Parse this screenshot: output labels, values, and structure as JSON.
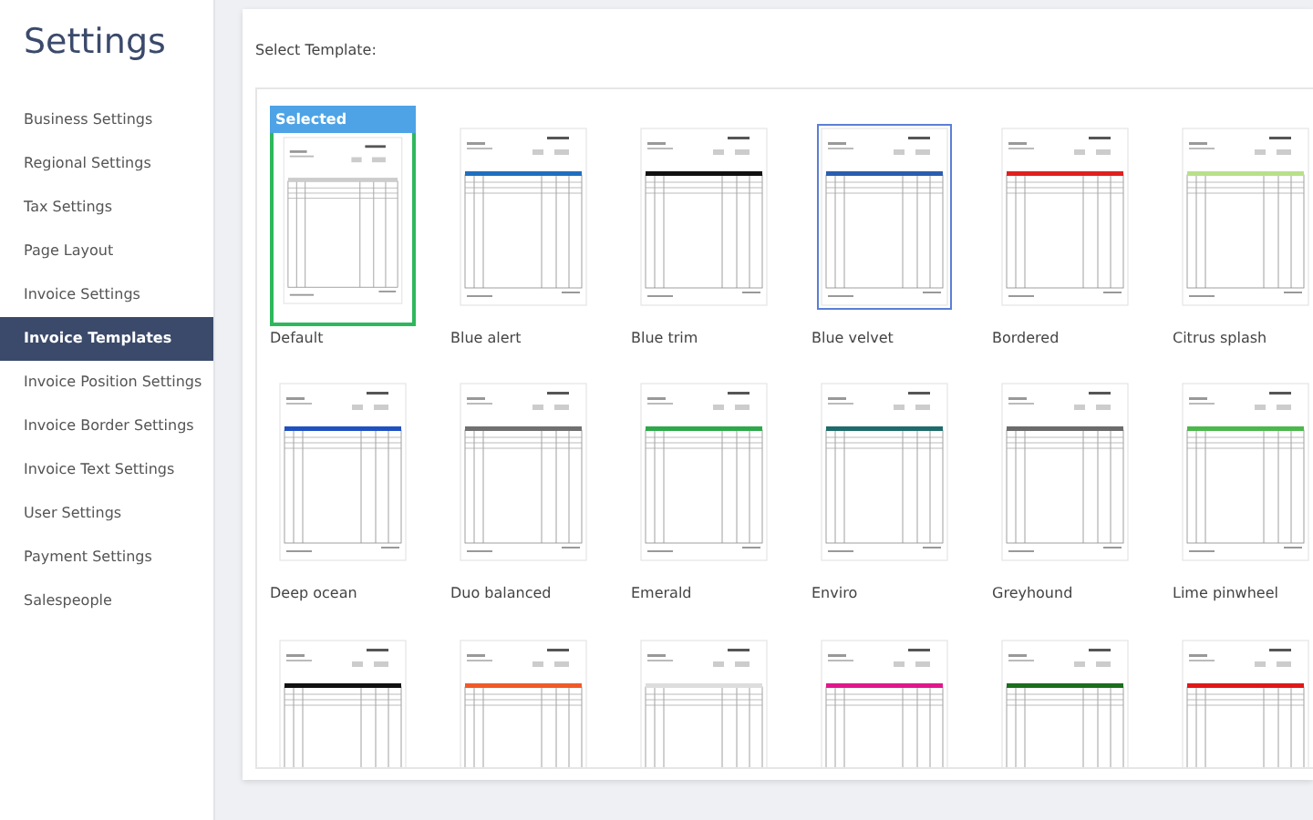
{
  "sidebar": {
    "title": "Settings",
    "items": [
      {
        "label": "Business Settings",
        "selected": false
      },
      {
        "label": "Regional Settings",
        "selected": false
      },
      {
        "label": "Tax Settings",
        "selected": false
      },
      {
        "label": "Page Layout",
        "selected": false
      },
      {
        "label": "Invoice Settings",
        "selected": false
      },
      {
        "label": "Invoice Templates",
        "selected": true
      },
      {
        "label": "Invoice Position Settings",
        "selected": false
      },
      {
        "label": "Invoice Border Settings",
        "selected": false
      },
      {
        "label": "Invoice Text Settings",
        "selected": false
      },
      {
        "label": "User Settings",
        "selected": false
      },
      {
        "label": "Payment Settings",
        "selected": false
      },
      {
        "label": "Salespeople",
        "selected": false
      }
    ]
  },
  "main": {
    "heading": "Select Template:",
    "selected_badge": "Selected",
    "templates": [
      {
        "name": "Default",
        "color": "#cccccc",
        "selected": true,
        "hovered": false
      },
      {
        "name": "Blue alert",
        "color": "#1f6fbf",
        "selected": false,
        "hovered": false
      },
      {
        "name": "Blue trim",
        "color": "#111111",
        "selected": false,
        "hovered": false
      },
      {
        "name": "Blue velvet",
        "color": "#2a5db0",
        "selected": false,
        "hovered": true
      },
      {
        "name": "Bordered",
        "color": "#e02020",
        "selected": false,
        "hovered": false
      },
      {
        "name": "Citrus splash",
        "color": "#b8e08a",
        "selected": false,
        "hovered": false
      },
      {
        "name": "Deep ocean",
        "color": "#2050c0",
        "selected": false,
        "hovered": false
      },
      {
        "name": "Duo balanced",
        "color": "#707070",
        "selected": false,
        "hovered": false
      },
      {
        "name": "Emerald",
        "color": "#2ea84a",
        "selected": false,
        "hovered": false
      },
      {
        "name": "Enviro",
        "color": "#1f6b6b",
        "selected": false,
        "hovered": false
      },
      {
        "name": "Greyhound",
        "color": "#6b6b6b",
        "selected": false,
        "hovered": false
      },
      {
        "name": "Lime pinwheel",
        "color": "#4cb84c",
        "selected": false,
        "hovered": false
      },
      {
        "color": "#111111",
        "selected": false,
        "hovered": false
      },
      {
        "color": "#f05a28",
        "selected": false,
        "hovered": false
      },
      {
        "color": "#dddddd",
        "selected": false,
        "hovered": false
      },
      {
        "color": "#e0178c",
        "selected": false,
        "hovered": false
      },
      {
        "color": "#1b6e1b",
        "selected": false,
        "hovered": false
      },
      {
        "color": "#e01818",
        "selected": false,
        "hovered": false
      }
    ]
  }
}
